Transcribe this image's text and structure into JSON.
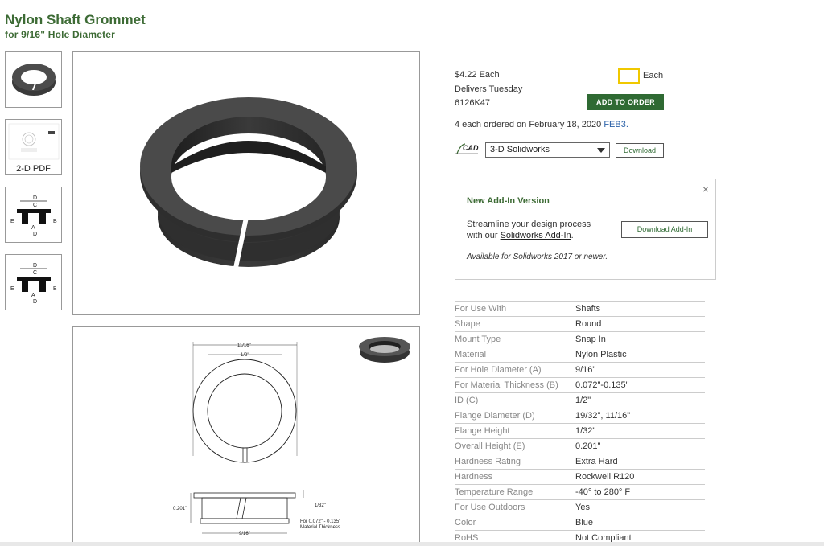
{
  "product": {
    "title": "Nylon Shaft Grommet",
    "subtitle": "for 9/16\" Hole Diameter"
  },
  "thumbnails": [
    {
      "name": "grommet-photo",
      "label": ""
    },
    {
      "name": "2d-pdf",
      "label": "2-D PDF"
    },
    {
      "name": "dimension-drawing-1",
      "label": ""
    },
    {
      "name": "dimension-drawing-2",
      "label": ""
    }
  ],
  "purchase": {
    "price": "$4.22 Each",
    "delivery": "Delivers Tuesday",
    "part_number": "6126K47",
    "qty_value": "",
    "each_label": "Each",
    "add_button": "ADD TO ORDER",
    "order_history": "4 each ordered on February 18, 2020",
    "order_link": "FEB3."
  },
  "cad": {
    "logo_text": "CAD",
    "selected": "3-D Solidworks",
    "download_label": "Download"
  },
  "addin": {
    "title": "New Add-In Version",
    "text_line1": "Streamline your design process",
    "text_line2_prefix": "with our",
    "link": "Solidworks Add-In",
    "text_line2_suffix": ".",
    "note": "Available for Solidworks 2017 or newer.",
    "button": "Download Add-In",
    "close": "×"
  },
  "drawing": {
    "dim_top": "11/16\"",
    "dim_inner": "1/2\"",
    "dim_height": "0.201\"",
    "dim_flange": "1/32\"",
    "dim_hole": "9/16\"",
    "dim_thickness_line1": "For 0.072\" - 0.135\"",
    "dim_thickness_line2": "Material Thickness"
  },
  "specs": [
    {
      "label": "For Use With",
      "value": "Shafts"
    },
    {
      "label": "Shape",
      "value": "Round"
    },
    {
      "label": "Mount Type",
      "value": "Snap In"
    },
    {
      "label": "Material",
      "value": "Nylon Plastic"
    },
    {
      "label": "For Hole Diameter (A)",
      "value": "9/16\""
    },
    {
      "label": "For Material Thickness (B)",
      "value": "0.072\"-0.135\""
    },
    {
      "label": "ID (C)",
      "value": "1/2\""
    },
    {
      "label": "Flange Diameter (D)",
      "value": "19/32\", 11/16\""
    },
    {
      "label": "Flange Height",
      "value": "1/32\""
    },
    {
      "label": "Overall Height (E)",
      "value": "0.201\""
    },
    {
      "label": "Hardness Rating",
      "value": "Extra Hard"
    },
    {
      "label": "Hardness",
      "value": "Rockwell R120"
    },
    {
      "label": "Temperature Range",
      "value": "-40° to 280° F"
    },
    {
      "label": "For Use Outdoors",
      "value": "Yes"
    },
    {
      "label": "Color",
      "value": "Blue"
    },
    {
      "label": "RoHS",
      "value": "Not Compliant"
    }
  ],
  "colors": {
    "brand_green": "#3d6b35",
    "button_green": "#2f6a33",
    "link_blue": "#2c62a8",
    "qty_highlight": "#f0c800"
  }
}
